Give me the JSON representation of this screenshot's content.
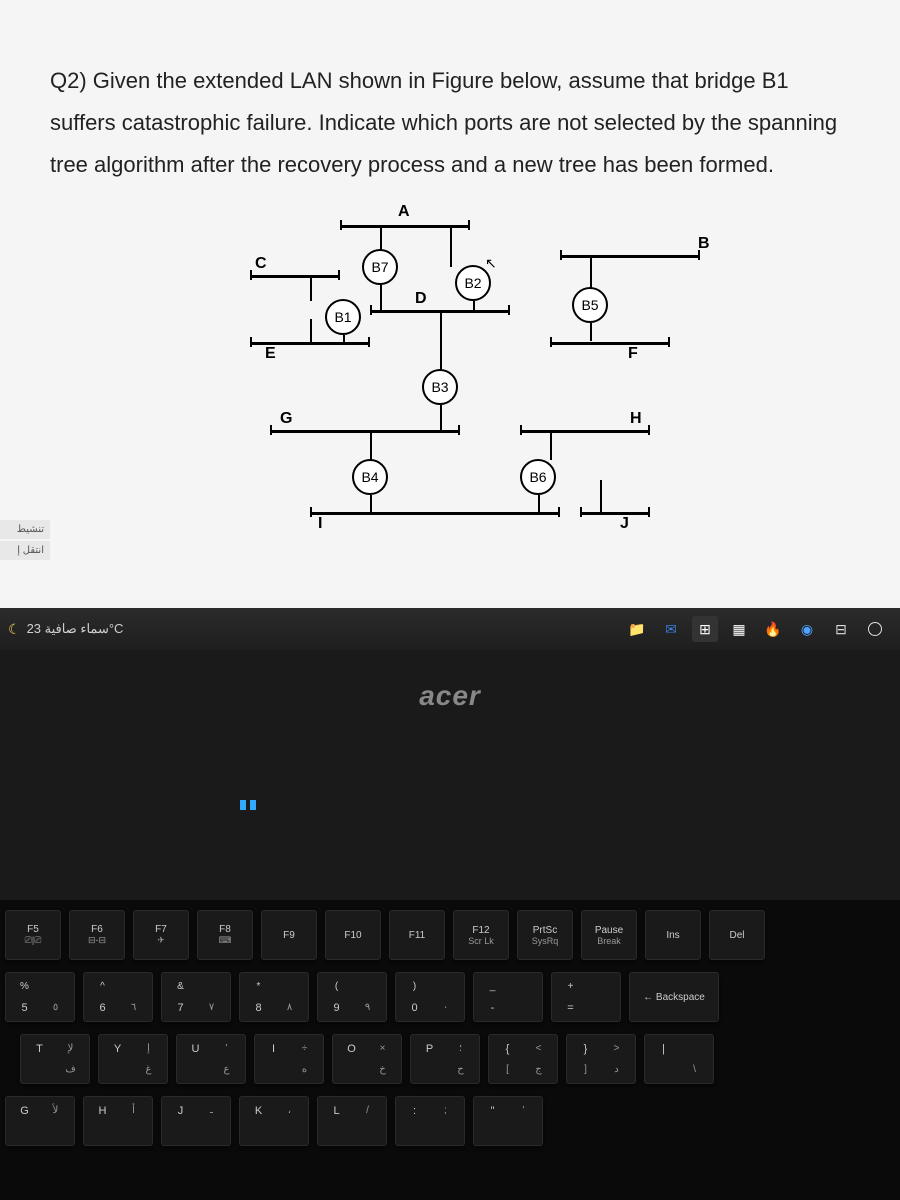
{
  "question": {
    "text": "Q2) Given the extended LAN shown in Figure below, assume that bridge B1 suffers catastrophic failure. Indicate which ports are not selected by the spanning tree algorithm after the recovery process and a new tree has been formed."
  },
  "diagram": {
    "segments": [
      "A",
      "B",
      "C",
      "D",
      "E",
      "F",
      "G",
      "H",
      "I",
      "J"
    ],
    "bridges": [
      "B1",
      "B2",
      "B3",
      "B4",
      "B5",
      "B6",
      "B7"
    ]
  },
  "taskbar": {
    "weather": "سماء صافية 23°C"
  },
  "sidebar": {
    "tab1": "تنشيط",
    "tab2": "انتقل إ"
  },
  "logo": "acer",
  "keyboard": {
    "fn_row": [
      {
        "main": "F5",
        "sub": "⎚|⎚"
      },
      {
        "main": "F6",
        "sub": "⊟-⊟"
      },
      {
        "main": "F7",
        "sub": "✈"
      },
      {
        "main": "F8",
        "sub": "⌨"
      },
      {
        "main": "F9",
        "sub": ""
      },
      {
        "main": "F10",
        "sub": ""
      },
      {
        "main": "F11",
        "sub": ""
      },
      {
        "main": "F12",
        "sub": "Scr Lk"
      },
      {
        "main": "PrtSc",
        "sub": "SysRq"
      },
      {
        "main": "Pause",
        "sub": "Break"
      },
      {
        "main": "Ins",
        "sub": ""
      },
      {
        "main": "Del",
        "sub": ""
      }
    ],
    "num_row": [
      {
        "top": "%",
        "main": "5",
        "ar": "٥"
      },
      {
        "top": "^",
        "main": "6",
        "ar": "٦"
      },
      {
        "top": "&",
        "main": "7",
        "ar": "٧"
      },
      {
        "top": "*",
        "main": "8",
        "ar": "٨"
      },
      {
        "top": "(",
        "main": "9",
        "ar": "٩"
      },
      {
        "top": ")",
        "main": "0",
        "ar": "٠"
      },
      {
        "top": "_",
        "main": "-",
        "ar": ""
      },
      {
        "top": "+",
        "main": "=",
        "ar": ""
      },
      {
        "top": "← Backspace",
        "main": "",
        "ar": ""
      }
    ],
    "qwerty_row": [
      {
        "main": "T",
        "ar1": "لإ",
        "ar2": "ف"
      },
      {
        "main": "Y",
        "ar1": "إ",
        "ar2": "غ"
      },
      {
        "main": "U",
        "ar1": "'",
        "ar2": "ع"
      },
      {
        "main": "I",
        "ar1": "÷",
        "ar2": "ه"
      },
      {
        "main": "O",
        "ar1": "×",
        "ar2": "خ"
      },
      {
        "main": "P",
        "ar1": "؛",
        "ar2": "ح"
      },
      {
        "main": "{",
        "ar1": "<",
        "ar2": "ج",
        "alt": "["
      },
      {
        "main": "}",
        "ar1": ">",
        "ar2": "د",
        "alt": "]"
      },
      {
        "main": "|",
        "ar1": "",
        "ar2": "\\",
        "alt": ""
      }
    ],
    "asdf_row": [
      {
        "main": "G",
        "ar": "لأ"
      },
      {
        "main": "H",
        "ar": "أ"
      },
      {
        "main": "J",
        "ar": "ـ"
      },
      {
        "main": "K",
        "ar": "،"
      },
      {
        "main": "L",
        "ar": "/"
      },
      {
        "main": ":",
        "ar": ";"
      },
      {
        "main": "\"",
        "ar": "'"
      }
    ]
  }
}
